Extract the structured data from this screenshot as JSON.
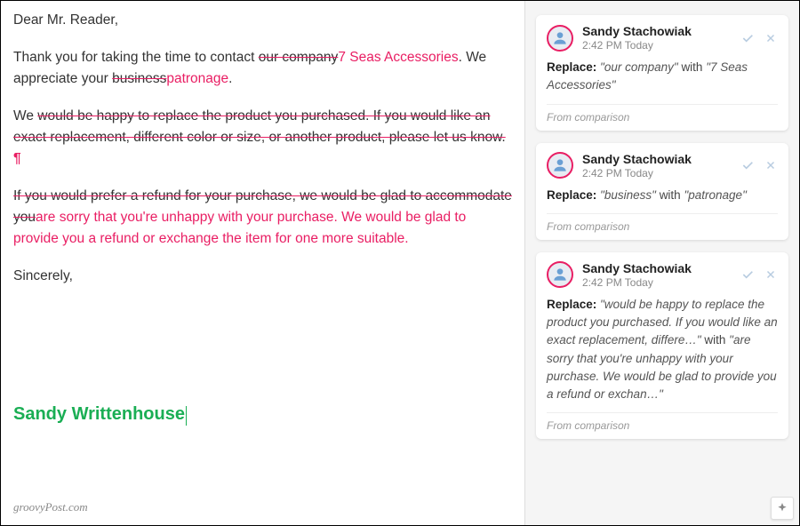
{
  "document": {
    "salutation": "Dear Mr. Reader,",
    "para1": {
      "t1": "Thank you for taking the time to contact ",
      "del1": "our company",
      "ins1": "7 Seas Accessories",
      "t2": ". We appreciate your ",
      "del2": "business",
      "ins2": "patronage",
      "t3": "."
    },
    "para2": {
      "t1": "We ",
      "del1": "would be happy to replace the product you purchased. If you would like an exact replacement, different color or size, or another product, please let us know.",
      "pilcrow": "¶"
    },
    "para3": {
      "del1": "If you would prefer a refund for your purchase, we would be glad to accommodate you",
      "ins1": "are sorry that you're unhappy with your purchase. We would be glad to provide you a refund or exchange the item for one more suitable",
      "t1": "."
    },
    "closing": "Sincerely,",
    "signature": "Sandy Writtenhouse"
  },
  "comments": [
    {
      "author": "Sandy Stachowiak",
      "time": "2:42 PM Today",
      "label": "Replace:",
      "old": "\"our company\"",
      "with": "with",
      "new": "\"7 Seas Accessories\"",
      "source": "From comparison"
    },
    {
      "author": "Sandy Stachowiak",
      "time": "2:42 PM Today",
      "label": "Replace:",
      "old": "\"business\"",
      "with": "with",
      "new": "\"patronage\"",
      "source": "From comparison"
    },
    {
      "author": "Sandy Stachowiak",
      "time": "2:42 PM Today",
      "label": "Replace:",
      "old": "\"would be happy to replace the product you purchased. If you would like an exact replacement, differe…\"",
      "with": "with",
      "new": "\"are sorry that you're unhappy with your purchase. We would be glad to provide you a refund or exchan…\"",
      "source": "From comparison"
    }
  ],
  "watermark": "groovyPost.com"
}
